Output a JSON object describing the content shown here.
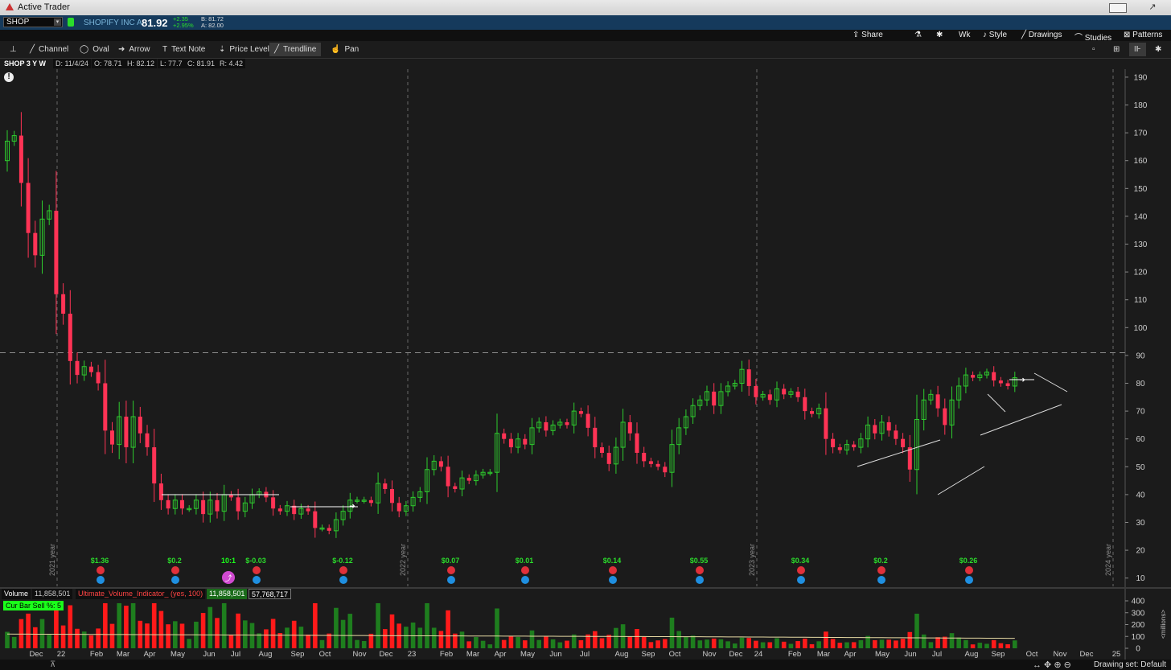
{
  "window": {
    "title": "Active Trader"
  },
  "quote": {
    "symbol": "SHOP",
    "name": "SHOPIFY INC A",
    "last": "81.92",
    "change": "+2.35",
    "change_pct": "+2.95%",
    "bid": "B: 81.72",
    "ask": "A: 82.00"
  },
  "toolbar_top": {
    "share": "Share",
    "timeframe": "Wk",
    "style": "Style",
    "drawings": "Drawings",
    "studies": "Studies",
    "patterns": "Patterns"
  },
  "drawing_tools": [
    "Channel",
    "Oval",
    "Arrow",
    "Text Note",
    "Price Level",
    "Trendline",
    "Pan"
  ],
  "active_tool": "Trendline",
  "info_bar": {
    "symbol": "SHOP 3 Y W",
    "date": "D: 11/4/24",
    "open": "O: 78.71",
    "high": "H: 82.12",
    "low": "L: 77.7",
    "close": "C: 81.91",
    "range": "R: 4.42"
  },
  "volume_bar": {
    "label": "Volume",
    "value": "11,858,501",
    "indicator": "Ultimate_Volume_Indicator_ (yes, 100)",
    "indicator_value": "11,858,501",
    "avg": "57,768,717"
  },
  "cur_bar": "Cur Bar Sell %: 5",
  "drawing_set": "Drawing set: Default",
  "colors": {
    "up": "#2ecc2e",
    "down": "#ff3355",
    "background": "#1b1b1b",
    "volume_up": "#1e7e1e",
    "volume_down": "#ff1a1a"
  },
  "chart_data": {
    "type": "candlestick",
    "y_axis": {
      "ticks": [
        10,
        20,
        30,
        40,
        50,
        60,
        70,
        80,
        90,
        100,
        110,
        120,
        130,
        140,
        150,
        160,
        170,
        180,
        190
      ],
      "ylim": [
        7.6,
        192
      ]
    },
    "x_labels": [
      [
        "Dec",
        45
      ],
      [
        "22",
        76
      ],
      [
        "Feb",
        120
      ],
      [
        "Mar",
        153
      ],
      [
        "Apr",
        186
      ],
      [
        "May",
        221
      ],
      [
        "Jun",
        260
      ],
      [
        "Jul",
        293
      ],
      [
        "Aug",
        330
      ],
      [
        "Sep",
        370
      ],
      [
        "Oct",
        404
      ],
      [
        "Nov",
        447
      ],
      [
        "Dec",
        480
      ],
      [
        "23",
        512
      ],
      [
        "Feb",
        555
      ],
      [
        "Mar",
        588
      ],
      [
        "Apr",
        622
      ],
      [
        "May",
        656
      ],
      [
        "Jun",
        691
      ],
      [
        "Jul",
        727
      ],
      [
        "Aug",
        773
      ],
      [
        "Sep",
        806
      ],
      [
        "Oct",
        839
      ],
      [
        "Nov",
        882
      ],
      [
        "Dec",
        915
      ],
      [
        "24",
        943
      ],
      [
        "Feb",
        988
      ],
      [
        "Mar",
        1024
      ],
      [
        "Apr",
        1057
      ],
      [
        "May",
        1097
      ],
      [
        "Jun",
        1132
      ],
      [
        "Jul",
        1165
      ],
      [
        "Aug",
        1208
      ],
      [
        "Sep",
        1241
      ],
      [
        "Oct",
        1283
      ],
      [
        "Nov",
        1318
      ],
      [
        "Dec",
        1351
      ],
      [
        "25",
        1388
      ]
    ],
    "year_markers": [
      {
        "label": "2021 year",
        "x": 71
      },
      {
        "label": "2022 year",
        "x": 507
      },
      {
        "label": "2023 year",
        "x": 941
      },
      {
        "label": "2024 year",
        "x": 1384
      }
    ],
    "reference_line": 91,
    "closes": [
      167,
      169,
      152,
      134,
      126,
      139,
      142,
      112,
      105,
      88,
      83,
      86,
      84,
      80,
      63,
      58,
      68,
      57,
      68,
      62,
      57,
      44,
      38,
      35,
      38,
      35,
      35,
      38,
      33,
      38,
      34,
      40,
      39,
      34,
      37,
      40,
      41,
      39,
      35,
      34,
      36,
      33,
      35,
      34,
      28,
      28,
      27,
      31,
      34,
      38,
      38,
      38,
      37,
      44,
      42,
      37,
      34,
      36,
      39,
      41,
      49,
      52,
      50,
      43,
      42,
      46,
      45,
      47,
      48,
      48,
      62,
      60,
      57,
      60,
      58,
      64,
      66,
      63,
      65,
      66,
      65,
      70,
      69,
      64,
      57,
      55,
      51,
      57,
      66,
      62,
      55,
      52,
      51,
      50,
      48,
      58,
      64,
      68,
      72,
      74,
      77,
      72,
      77,
      79,
      80,
      85,
      79,
      75,
      76,
      74,
      78,
      76,
      77,
      75,
      70,
      69,
      71,
      60,
      57,
      56,
      58,
      57,
      60,
      65,
      62,
      66,
      63,
      60,
      57,
      49,
      67,
      74,
      76,
      71,
      65,
      74,
      79,
      83,
      82,
      83,
      84,
      81,
      80,
      79,
      82
    ],
    "earnings": [
      {
        "label": "$1.36",
        "x": 124
      },
      {
        "label": "$0.2",
        "x": 217
      },
      {
        "label": "10:1",
        "x": 284
      },
      {
        "label": "$-0.03",
        "x": 318
      },
      {
        "label": "$-0.12",
        "x": 426
      },
      {
        "label": "$0.07",
        "x": 560
      },
      {
        "label": "$0.01",
        "x": 652
      },
      {
        "label": "$0.14",
        "x": 761
      },
      {
        "label": "$0.55",
        "x": 869
      },
      {
        "label": "$0.34",
        "x": 995
      },
      {
        "label": "$0.2",
        "x": 1095
      },
      {
        "label": "$0.26",
        "x": 1204
      }
    ],
    "volume_ticks": [
      0,
      100,
      200,
      300,
      400
    ],
    "volume_unit": "<millions>"
  }
}
